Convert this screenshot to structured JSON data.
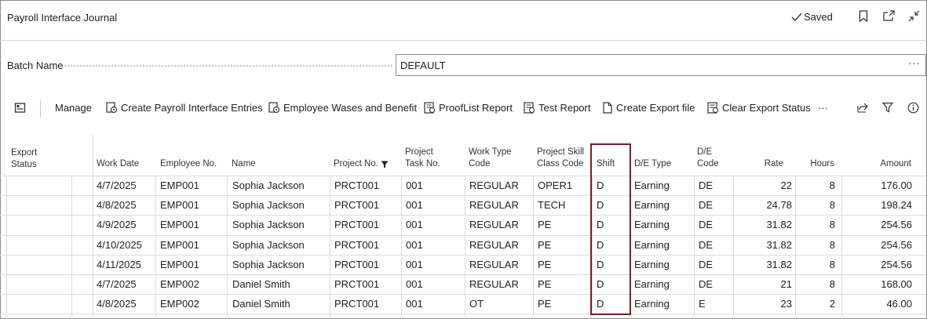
{
  "header": {
    "title": "Payroll Interface Journal",
    "saved_label": "Saved",
    "icons": [
      "bookmark-icon",
      "open-new-window-icon",
      "collapse-icon"
    ]
  },
  "batch": {
    "label": "Batch Name",
    "value": "DEFAULT",
    "more": "···"
  },
  "toolbar": {
    "manage": "Manage",
    "create_entries": "Create Payroll Interface Entries",
    "employee_wages": "Employee Wases and Benefit",
    "prooflist": "ProofList Report",
    "test_report": "Test Report",
    "create_export": "Create Export file",
    "clear_export": "Clear Export Status",
    "more": "···"
  },
  "columns": {
    "export_status": "Export Status",
    "work_date": "Work Date",
    "employee_no": "Employee No.",
    "name": "Name",
    "project_no": "Project No.",
    "project_task_no": "Project Task No.",
    "work_type_code": "Work Type Code",
    "project_skill_class_code": "Project Skill Class Code",
    "shift": "Shift",
    "de_type": "D/E Type",
    "de_code": "D/E Code",
    "rate": "Rate",
    "hours": "Hours",
    "amount": "Amount"
  },
  "rows": [
    {
      "work_date": "4/7/2025",
      "employee_no": "EMP001",
      "name": "Sophia Jackson",
      "project_no": "PRCT001",
      "task_no": "001",
      "work_type": "REGULAR",
      "skill_class": "OPER1",
      "shift": "D",
      "de_type": "Earning",
      "de_code": "DE",
      "rate": "22",
      "hours": "8",
      "amount": "176.00"
    },
    {
      "work_date": "4/8/2025",
      "employee_no": "EMP001",
      "name": "Sophia Jackson",
      "project_no": "PRCT001",
      "task_no": "001",
      "work_type": "REGULAR",
      "skill_class": "TECH",
      "shift": "D",
      "de_type": "Earning",
      "de_code": "DE",
      "rate": "24.78",
      "hours": "8",
      "amount": "198.24"
    },
    {
      "work_date": "4/9/2025",
      "employee_no": "EMP001",
      "name": "Sophia Jackson",
      "project_no": "PRCT001",
      "task_no": "001",
      "work_type": "REGULAR",
      "skill_class": "PE",
      "shift": "D",
      "de_type": "Earning",
      "de_code": "DE",
      "rate": "31.82",
      "hours": "8",
      "amount": "254.56"
    },
    {
      "work_date": "4/10/2025",
      "employee_no": "EMP001",
      "name": "Sophia Jackson",
      "project_no": "PRCT001",
      "task_no": "001",
      "work_type": "REGULAR",
      "skill_class": "PE",
      "shift": "D",
      "de_type": "Earning",
      "de_code": "DE",
      "rate": "31.82",
      "hours": "8",
      "amount": "254.56"
    },
    {
      "work_date": "4/11/2025",
      "employee_no": "EMP001",
      "name": "Sophia Jackson",
      "project_no": "PRCT001",
      "task_no": "001",
      "work_type": "REGULAR",
      "skill_class": "PE",
      "shift": "D",
      "de_type": "Earning",
      "de_code": "DE",
      "rate": "31.82",
      "hours": "8",
      "amount": "254.56"
    },
    {
      "work_date": "4/7/2025",
      "employee_no": "EMP002",
      "name": "Daniel Smith",
      "project_no": "PRCT001",
      "task_no": "001",
      "work_type": "REGULAR",
      "skill_class": "PE",
      "shift": "D",
      "de_type": "Earning",
      "de_code": "DE",
      "rate": "21",
      "hours": "8",
      "amount": "168.00"
    },
    {
      "work_date": "4/8/2025",
      "employee_no": "EMP002",
      "name": "Daniel Smith",
      "project_no": "PRCT001",
      "task_no": "001",
      "work_type": "OT",
      "skill_class": "PE",
      "shift": "D",
      "de_type": "Earning",
      "de_code": "E",
      "rate": "23",
      "hours": "2",
      "amount": "46.00"
    }
  ],
  "colors": {
    "highlight": "#7b1e22",
    "grid_line": "#dcdcdc"
  }
}
